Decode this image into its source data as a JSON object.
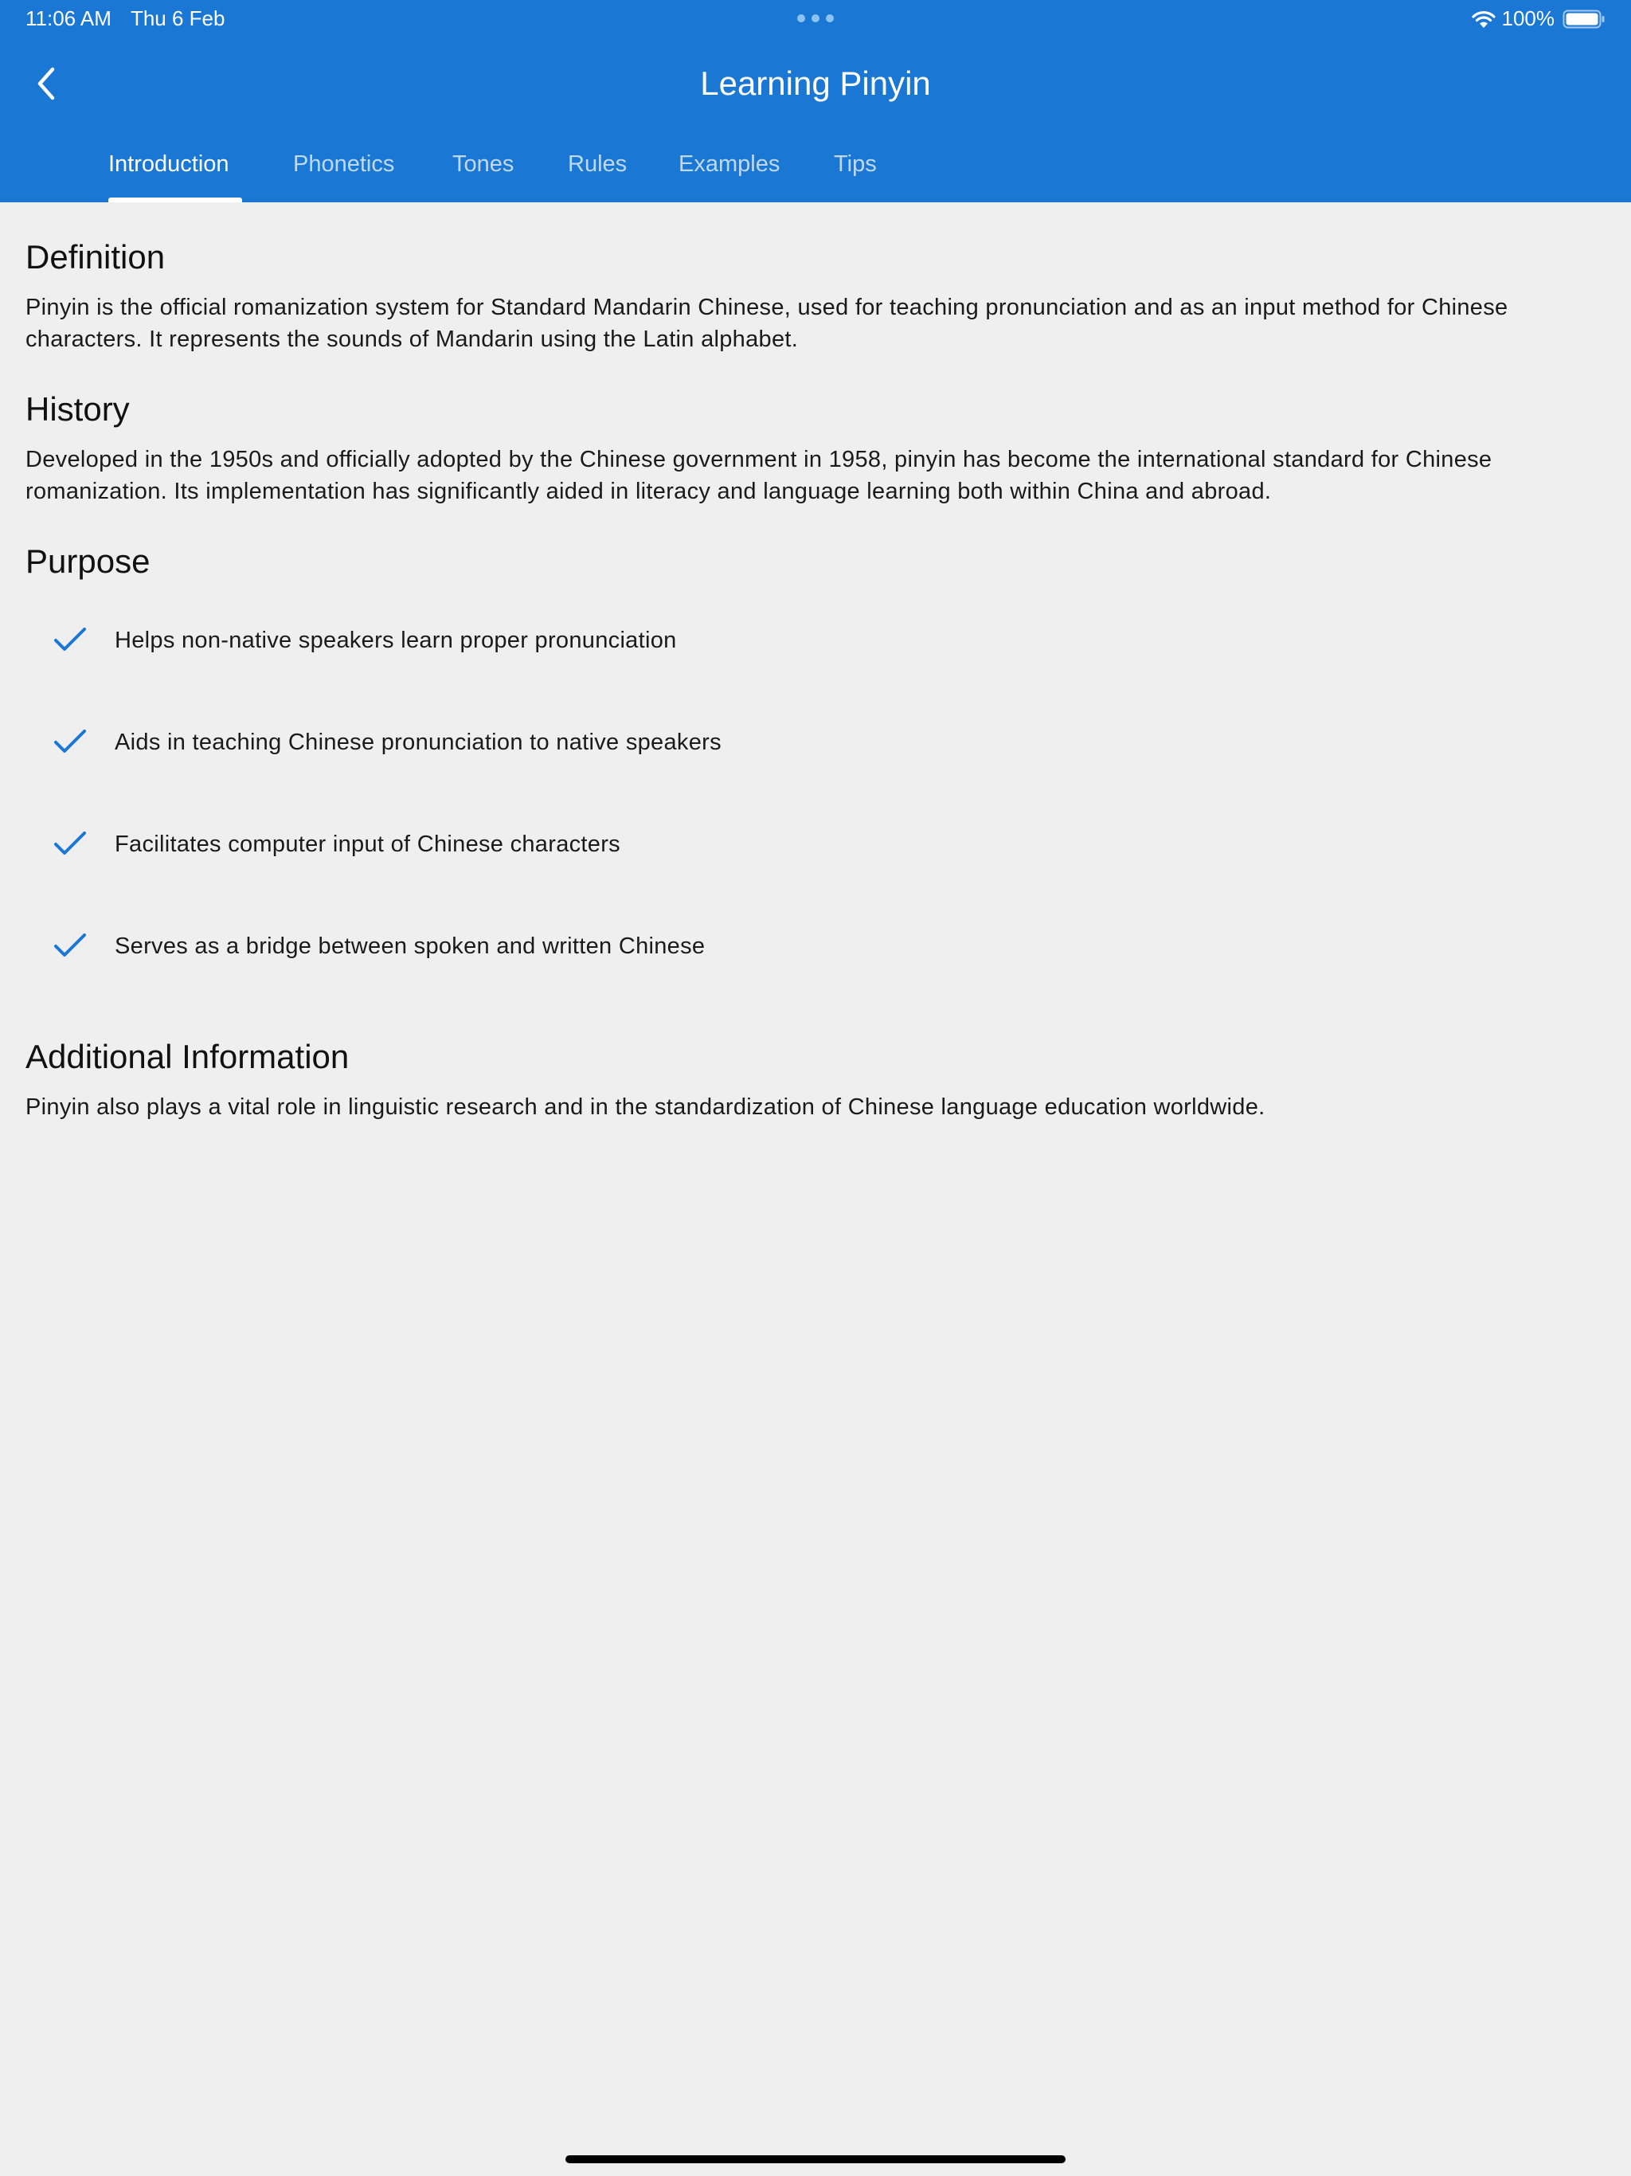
{
  "status_bar": {
    "time": "11:06 AM",
    "date": "Thu 6 Feb",
    "battery_percent": "100%",
    "wifi_icon": "wifi-icon",
    "battery_icon": "battery-icon"
  },
  "header": {
    "title": "Learning Pinyin",
    "back_icon": "chevron-left-icon",
    "background_color": "#1a77d4"
  },
  "tabs": [
    {
      "label": "Introduction",
      "active": true
    },
    {
      "label": "Phonetics",
      "active": false
    },
    {
      "label": "Tones",
      "active": false
    },
    {
      "label": "Rules",
      "active": false
    },
    {
      "label": "Examples",
      "active": false
    },
    {
      "label": "Tips",
      "active": false
    }
  ],
  "sections": {
    "definition": {
      "heading": "Definition",
      "text": "Pinyin is the official romanization system for Standard Mandarin Chinese, used for teaching pronunciation and as an input method for Chinese characters. It represents the sounds of Mandarin using the Latin alphabet."
    },
    "history": {
      "heading": "History",
      "text": "Developed in the 1950s and officially adopted by the Chinese government in 1958, pinyin has become the international standard for Chinese romanization. Its implementation has significantly aided in literacy and language learning both within China and abroad."
    },
    "purpose": {
      "heading": "Purpose",
      "check_icon": "checkmark-icon",
      "check_color": "#1a77d4",
      "items": [
        "Helps non-native speakers learn proper pronunciation",
        "Aids in teaching Chinese pronunciation to native speakers",
        "Facilitates computer input of Chinese characters",
        "Serves as a bridge between spoken and written Chinese"
      ]
    },
    "additional": {
      "heading": "Additional Information",
      "text": "Pinyin also plays a vital role in linguistic research and in the standardization of Chinese language education worldwide."
    }
  }
}
